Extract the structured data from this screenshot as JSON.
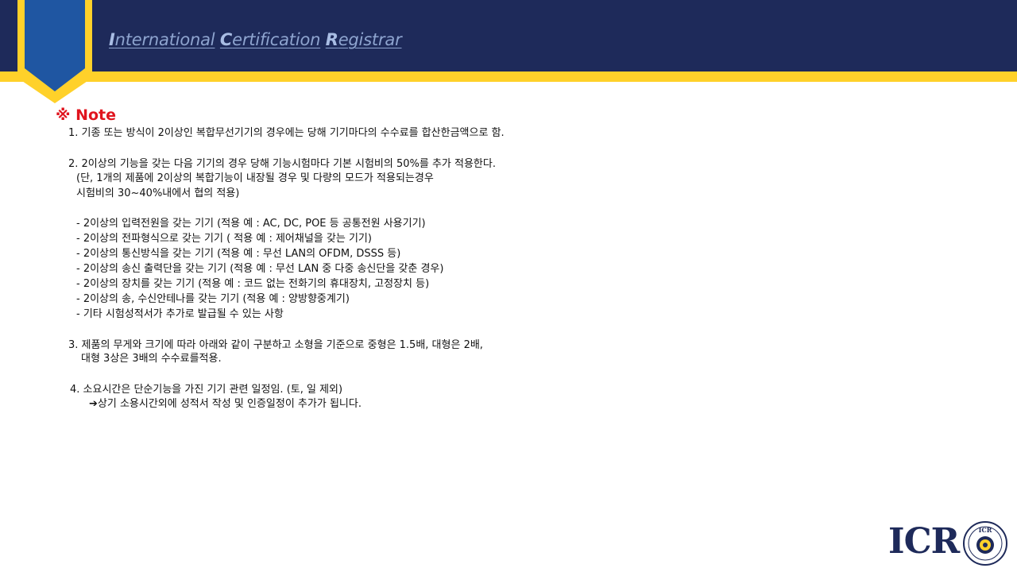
{
  "header": {
    "title_parts": [
      {
        "cap": "I",
        "rest": "nternational"
      },
      {
        "cap": "C",
        "rest": "ertification"
      },
      {
        "cap": "R",
        "rest": "egistrar"
      }
    ]
  },
  "note": {
    "heading": "※ Note",
    "lines": [
      "1. 기종 또는 방식이 2이상인 복합무선기기의 경우에는 당해 기기마다의 수수료를 합산한금액으로 함.",
      "",
      "2. 2이상의 기능을 갖는 다음 기기의 경우 당해 기능시험마다 기본 시험비의 50%를 추가 적용한다.",
      "(단, 1개의 제품에 2이상의 복합기능이 내장될 경우 및 다량의 모드가 적용되는경우",
      "시험비의 30~40%내에서 협의 적용)",
      "",
      "- 2이상의 입력전원을 갖는 기기 (적용 예 : AC, DC, POE 등 공통전원 사용기기)",
      "- 2이상의 전파형식으로 갖는 기기 ( 적용 예 : 제어채널을 갖는 기기)",
      "- 2이상의 통신방식을 갖는 기기 (적용 예 : 무선 LAN의 OFDM, DSSS 등)",
      "- 2이상의 송신 출력단을 갖는 기기 (적용 예 : 무선 LAN 중 다중 송신단을 갖춘 경우)",
      "- 2이상의 장치를 갖는 기기 (적용 예 : 코드 없는 전화기의 휴대장치, 고정장치 등)",
      "- 2이상의 송, 수신안테나를 갖는 기기 (적용 예 : 양방향중계기)",
      "- 기타 시험성적서가 추가로 발급될 수 있는 사항",
      "",
      "3. 제품의 무게와 크기에 따라 아래와 같이 구분하고 소형을 기준으로 중형은 1.5배, 대형은 2배,",
      "대형 3상은 3배의 수수료를적용.",
      "",
      "4. 소요시간은 단순기능을 가진 기기 관련 일정임. (토, 일 제외)",
      "➔상기 소용시간외에 성적서 작성 및 인증일정이 추가가 됩니다."
    ]
  },
  "logo": {
    "text": "ICR",
    "seal_text": "ICR",
    "seal_ring_text": "INTERNATIONAL CERTIFICATION REGISTRAR"
  },
  "colors": {
    "navy": "#1e2a5a",
    "gold": "#ffd12a",
    "bookmark_blue": "#1f56a2",
    "note_red": "#e0141e"
  }
}
